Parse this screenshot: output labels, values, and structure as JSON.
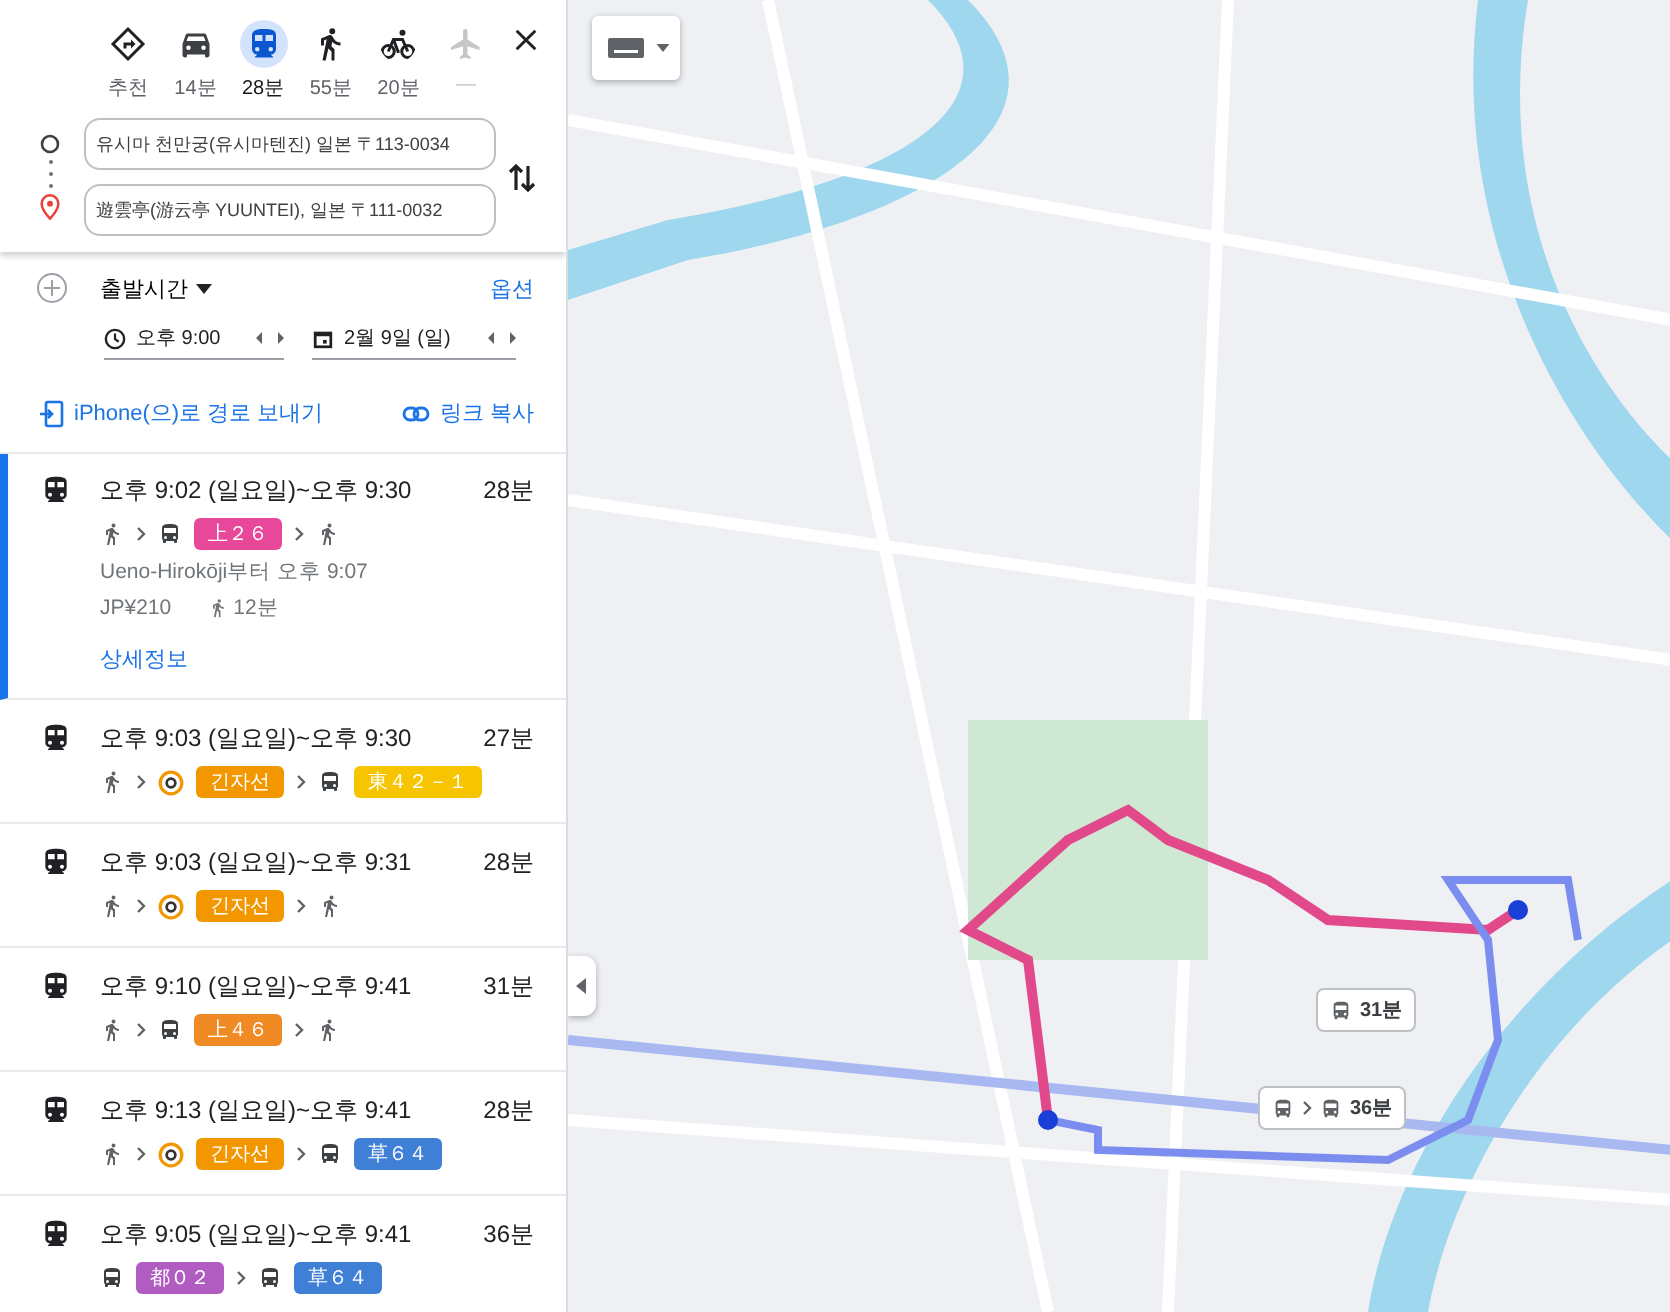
{
  "modes": [
    {
      "kind": "recommended",
      "label": "추천",
      "selected": false,
      "disabled": false
    },
    {
      "kind": "car",
      "label": "14분",
      "selected": false,
      "disabled": false
    },
    {
      "kind": "transit",
      "label": "28분",
      "selected": true,
      "disabled": false
    },
    {
      "kind": "walk",
      "label": "55분",
      "selected": false,
      "disabled": false
    },
    {
      "kind": "bike",
      "label": "20분",
      "selected": false,
      "disabled": false
    },
    {
      "kind": "flight",
      "label": "—",
      "selected": false,
      "disabled": true
    }
  ],
  "origin": {
    "value": "유시마 천만궁(유시마텐진) 일본 〒113-0034"
  },
  "destination": {
    "value": "遊雲亭(游云亭 YUUNTEI), 일본 〒111-0032"
  },
  "departure": {
    "label": "출발시간",
    "options": "옵션",
    "time": "오후 9:00",
    "date": "2월 9일 (일)"
  },
  "share": {
    "send": "iPhone(으)로 경로 보내기",
    "copy": "링크 복사"
  },
  "routes": [
    {
      "selected": true,
      "time": "오후 9:02 (일요일)~오후 9:30",
      "duration": "28분",
      "steps": [
        {
          "kind": "walk"
        },
        {
          "kind": "bus"
        },
        {
          "kind": "badge",
          "label": "上２６",
          "color": "#e8489a"
        },
        {
          "kind": "walk"
        }
      ],
      "detail": "Ueno-Hirokōji부터 오후 9:07",
      "fare": "JP¥210",
      "walk": "12분",
      "more": "상세정보"
    },
    {
      "selected": false,
      "time": "오후 9:03 (일요일)~오후 9:30",
      "duration": "27분",
      "steps": [
        {
          "kind": "walk"
        },
        {
          "kind": "metro"
        },
        {
          "kind": "badge",
          "label": "긴자선",
          "color": "#f39700"
        },
        {
          "kind": "bus"
        },
        {
          "kind": "badge",
          "label": "東４２－１",
          "color": "#f6c500"
        }
      ]
    },
    {
      "selected": false,
      "time": "오후 9:03 (일요일)~오후 9:31",
      "duration": "28분",
      "steps": [
        {
          "kind": "walk"
        },
        {
          "kind": "metro"
        },
        {
          "kind": "badge",
          "label": "긴자선",
          "color": "#f39700"
        },
        {
          "kind": "walk"
        }
      ]
    },
    {
      "selected": false,
      "time": "오후 9:10 (일요일)~오후 9:41",
      "duration": "31분",
      "steps": [
        {
          "kind": "walk"
        },
        {
          "kind": "bus"
        },
        {
          "kind": "badge",
          "label": "上４６",
          "color": "#f08a24"
        },
        {
          "kind": "walk"
        }
      ]
    },
    {
      "selected": false,
      "time": "오후 9:13 (일요일)~오후 9:41",
      "duration": "28분",
      "steps": [
        {
          "kind": "walk"
        },
        {
          "kind": "metro"
        },
        {
          "kind": "badge",
          "label": "긴자선",
          "color": "#f39700"
        },
        {
          "kind": "bus"
        },
        {
          "kind": "badge",
          "label": "草６４",
          "color": "#3f7fd6"
        }
      ]
    },
    {
      "selected": false,
      "time": "오후 9:05 (일요일)~오후 9:41",
      "duration": "36분",
      "steps": [
        {
          "kind": "bus"
        },
        {
          "kind": "badge",
          "label": "都０２",
          "color": "#b05cc0"
        },
        {
          "kind": "bus"
        },
        {
          "kind": "badge",
          "label": "草６４",
          "color": "#3f7fd6"
        }
      ]
    }
  ],
  "map_chips": [
    {
      "kind": "single",
      "label": "31분"
    },
    {
      "kind": "transfer",
      "label": "36분"
    }
  ]
}
